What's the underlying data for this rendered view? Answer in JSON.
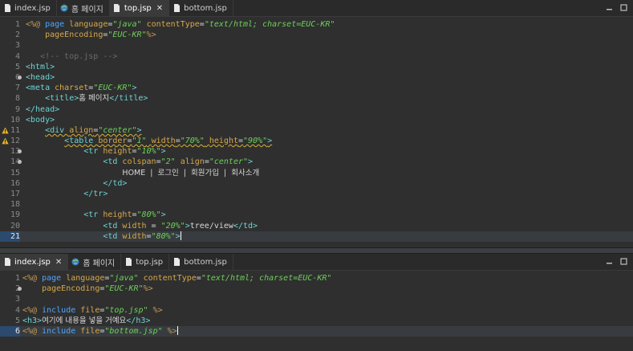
{
  "top_editor": {
    "tabs": [
      {
        "label": "index.jsp",
        "icon": "jsp-file-icon",
        "active": false
      },
      {
        "label": "홈 페이지",
        "icon": "globe-icon",
        "active": false
      },
      {
        "label": "top.jsp",
        "icon": "jsp-file-icon",
        "active": true
      },
      {
        "label": "bottom.jsp",
        "icon": "jsp-file-icon",
        "active": false
      }
    ],
    "current_line": 21,
    "lines": [
      {
        "n": "1",
        "tokens": [
          [
            "dir",
            "<%@ "
          ],
          [
            "kw",
            "page "
          ],
          [
            "attr",
            "language"
          ],
          [
            "plain",
            "="
          ],
          [
            "str",
            "\"java\""
          ],
          [
            "plain",
            " "
          ],
          [
            "attr",
            "contentType"
          ],
          [
            "plain",
            "="
          ],
          [
            "str",
            "\"text/html; charset=EUC-KR\""
          ]
        ]
      },
      {
        "n": "2",
        "tokens": [
          [
            "plain",
            "    "
          ],
          [
            "attr",
            "pageEncoding"
          ],
          [
            "plain",
            "="
          ],
          [
            "str",
            "\"EUC-KR\""
          ],
          [
            "dir",
            "%>"
          ]
        ]
      },
      {
        "n": "3",
        "tokens": []
      },
      {
        "n": "4",
        "tokens": [
          [
            "plain",
            "   "
          ],
          [
            "com",
            "<!-- top.jsp -->"
          ]
        ]
      },
      {
        "n": "5",
        "tokens": [
          [
            "tag",
            "<html>"
          ]
        ]
      },
      {
        "n": "6",
        "tokens": [
          [
            "tag",
            "<head>"
          ]
        ]
      },
      {
        "n": "7",
        "tokens": [
          [
            "tag",
            "<meta "
          ],
          [
            "attr",
            "charset"
          ],
          [
            "plain",
            "="
          ],
          [
            "str",
            "\"EUC-KR\""
          ],
          [
            "tag",
            ">"
          ]
        ]
      },
      {
        "n": "8",
        "tokens": [
          [
            "plain",
            "    "
          ],
          [
            "tag",
            "<title>"
          ],
          [
            "txt",
            "홈 페이지"
          ],
          [
            "tag",
            "</title>"
          ]
        ]
      },
      {
        "n": "9",
        "tokens": [
          [
            "tag",
            "</head>"
          ]
        ]
      },
      {
        "n": "10",
        "tokens": [
          [
            "tag",
            "<body>"
          ]
        ]
      },
      {
        "n": "11",
        "tokens": [
          [
            "plain",
            "    "
          ],
          [
            "tag",
            "<div "
          ],
          [
            "attr",
            "align"
          ],
          [
            "plain",
            "="
          ],
          [
            "str",
            "\"center\""
          ],
          [
            "tag",
            ">"
          ]
        ]
      },
      {
        "n": "12",
        "tokens": [
          [
            "plain",
            "        "
          ],
          [
            "tag",
            "<table "
          ],
          [
            "attr",
            "border"
          ],
          [
            "plain",
            "="
          ],
          [
            "str",
            "\"1\""
          ],
          [
            "plain",
            " "
          ],
          [
            "attr",
            "width"
          ],
          [
            "plain",
            "="
          ],
          [
            "str",
            "\"70%\""
          ],
          [
            "plain",
            " "
          ],
          [
            "attr",
            "height"
          ],
          [
            "plain",
            "="
          ],
          [
            "str",
            "\"90%\""
          ],
          [
            "tag",
            ">"
          ]
        ]
      },
      {
        "n": "13",
        "tokens": [
          [
            "plain",
            "            "
          ],
          [
            "tag",
            "<tr "
          ],
          [
            "attr",
            "height"
          ],
          [
            "plain",
            "="
          ],
          [
            "str",
            "\"10%\""
          ],
          [
            "tag",
            ">"
          ]
        ]
      },
      {
        "n": "14",
        "tokens": [
          [
            "plain",
            "                "
          ],
          [
            "tag",
            "<td "
          ],
          [
            "attr",
            "colspan"
          ],
          [
            "plain",
            "="
          ],
          [
            "str",
            "\"2\""
          ],
          [
            "plain",
            " "
          ],
          [
            "attr",
            "align"
          ],
          [
            "plain",
            "="
          ],
          [
            "str",
            "\"center\""
          ],
          [
            "tag",
            ">"
          ]
        ]
      },
      {
        "n": "15",
        "tokens": [
          [
            "plain",
            "                    "
          ],
          [
            "txt",
            "HOME  |  로그인  |  회원가입  |  회사소개"
          ]
        ]
      },
      {
        "n": "16",
        "tokens": [
          [
            "plain",
            "                "
          ],
          [
            "tag",
            "</td>"
          ]
        ]
      },
      {
        "n": "17",
        "tokens": [
          [
            "plain",
            "            "
          ],
          [
            "tag",
            "</tr>"
          ]
        ]
      },
      {
        "n": "18",
        "tokens": []
      },
      {
        "n": "19",
        "tokens": [
          [
            "plain",
            "            "
          ],
          [
            "tag",
            "<tr "
          ],
          [
            "attr",
            "height"
          ],
          [
            "plain",
            "="
          ],
          [
            "str",
            "\"80%\""
          ],
          [
            "tag",
            ">"
          ]
        ]
      },
      {
        "n": "20",
        "tokens": [
          [
            "plain",
            "                "
          ],
          [
            "tag",
            "<td "
          ],
          [
            "attr",
            "width "
          ],
          [
            "plain",
            "= "
          ],
          [
            "str",
            "\"20%\""
          ],
          [
            "tag",
            ">"
          ],
          [
            "plain",
            "tree/view"
          ],
          [
            "tag",
            "</td>"
          ]
        ]
      },
      {
        "n": "21",
        "tokens": [
          [
            "plain",
            "                "
          ],
          [
            "tag",
            "<td "
          ],
          [
            "attr",
            "width"
          ],
          [
            "plain",
            "="
          ],
          [
            "str",
            "\"80%\""
          ],
          [
            "tag",
            ">"
          ]
        ]
      }
    ]
  },
  "bottom_editor": {
    "tabs": [
      {
        "label": "index.jsp",
        "icon": "jsp-file-icon",
        "active": true
      },
      {
        "label": "홈 페이지",
        "icon": "globe-icon",
        "active": false
      },
      {
        "label": "top.jsp",
        "icon": "jsp-file-icon",
        "active": false
      },
      {
        "label": "bottom.jsp",
        "icon": "jsp-file-icon",
        "active": false
      }
    ],
    "current_line": 6,
    "lines": [
      {
        "n": "1",
        "tokens": [
          [
            "dir",
            "<%@ "
          ],
          [
            "kw",
            "page "
          ],
          [
            "attr",
            "language"
          ],
          [
            "plain",
            "="
          ],
          [
            "str",
            "\"java\""
          ],
          [
            "plain",
            " "
          ],
          [
            "attr",
            "contentType"
          ],
          [
            "plain",
            "="
          ],
          [
            "str",
            "\"text/html; charset=EUC-KR\""
          ]
        ]
      },
      {
        "n": "2",
        "tokens": [
          [
            "plain",
            "    "
          ],
          [
            "attr",
            "pageEncoding"
          ],
          [
            "plain",
            "="
          ],
          [
            "str",
            "\"EUC-KR\""
          ],
          [
            "dir",
            "%>"
          ]
        ]
      },
      {
        "n": "3",
        "tokens": []
      },
      {
        "n": "4",
        "tokens": [
          [
            "dir",
            "<%@ "
          ],
          [
            "kw",
            "include "
          ],
          [
            "attr",
            "file"
          ],
          [
            "plain",
            "="
          ],
          [
            "str",
            "\"top.jsp\""
          ],
          [
            "dir",
            " %>"
          ]
        ]
      },
      {
        "n": "5",
        "tokens": [
          [
            "tag",
            "<h3>"
          ],
          [
            "txt",
            "여기에 내용을 넣을 거예요"
          ],
          [
            "tag",
            "</h3>"
          ]
        ]
      },
      {
        "n": "6",
        "tokens": [
          [
            "dir",
            "<%@ "
          ],
          [
            "kw",
            "include "
          ],
          [
            "attr",
            "file"
          ],
          [
            "plain",
            "="
          ],
          [
            "str",
            "\"bottom.jsp\""
          ],
          [
            "dir",
            " %>"
          ]
        ]
      }
    ]
  },
  "colors": {
    "keyword": "#4ea6ff",
    "attribute": "#d8a84a",
    "string": "#6dd05a",
    "tag": "#6fd3d3",
    "comment": "#6a6a6a",
    "directive": "#c59a53"
  }
}
